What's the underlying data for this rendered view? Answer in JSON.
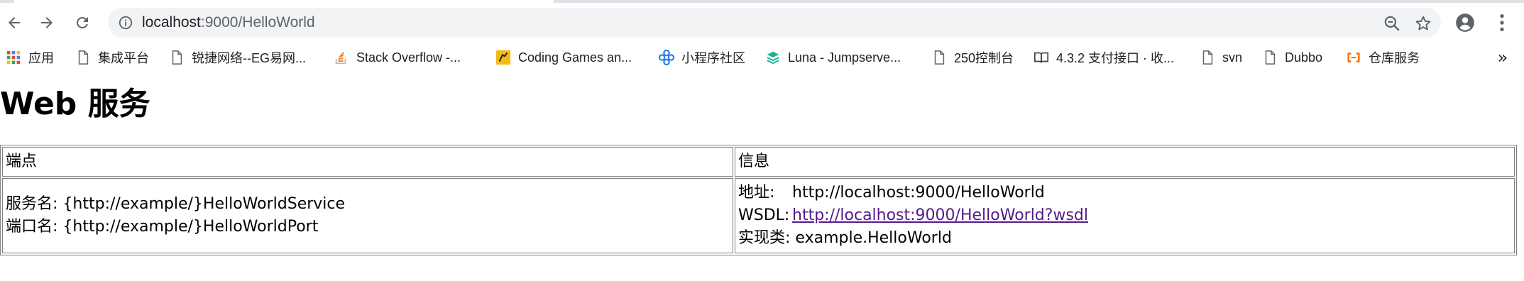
{
  "browser": {
    "url_host": "localhost",
    "url_path": ":9000/HelloWorld",
    "icons": {
      "back": "back-arrow-icon",
      "forward": "forward-arrow-icon",
      "reload": "reload-icon",
      "site_info": "info-icon",
      "zoom": "zoom-out-icon",
      "bookmark_star": "star-icon",
      "profile": "account-icon",
      "menu": "kebab-menu-icon"
    }
  },
  "bookmarks": {
    "items": [
      {
        "label": "应用",
        "icon": "apps-grid-icon"
      },
      {
        "label": "集成平台",
        "icon": "page-icon"
      },
      {
        "label": "锐捷网络--EG易网...",
        "icon": "page-icon"
      },
      {
        "label": "Stack Overflow -...",
        "icon": "stackoverflow-icon"
      },
      {
        "label": "Coding Games an...",
        "icon": "codingame-icon"
      },
      {
        "label": "小程序社区",
        "icon": "miniprogram-icon"
      },
      {
        "label": "Luna - Jumpserve...",
        "icon": "luna-icon"
      },
      {
        "label": "250控制台",
        "icon": "page-icon"
      },
      {
        "label": "4.3.2 支付接口 · 收...",
        "icon": "book-icon"
      },
      {
        "label": "svn",
        "icon": "page-icon"
      },
      {
        "label": "Dubbo",
        "icon": "page-icon"
      },
      {
        "label": "仓库服务",
        "icon": "aliyun-icon"
      }
    ],
    "more": "»"
  },
  "page": {
    "title": "Web 服务",
    "table": {
      "headers": [
        "端点",
        "信息"
      ],
      "endpoint": {
        "service_label": "服务名:",
        "service_value": "{http://example/}HelloWorldService",
        "port_label": "端口名:",
        "port_value": "{http://example/}HelloWorldPort"
      },
      "info": {
        "address_label": "地址:",
        "address_value": "http://localhost:9000/HelloWorld",
        "wsdl_label": "WSDL:",
        "wsdl_link": "http://localhost:9000/HelloWorld?wsdl",
        "impl_label": "实现类:",
        "impl_value": "example.HelloWorld"
      }
    }
  },
  "colors": {
    "omnibox_bg": "#f1f3f4",
    "link_visited": "#551a8b",
    "icon_gray": "#5f6368"
  }
}
